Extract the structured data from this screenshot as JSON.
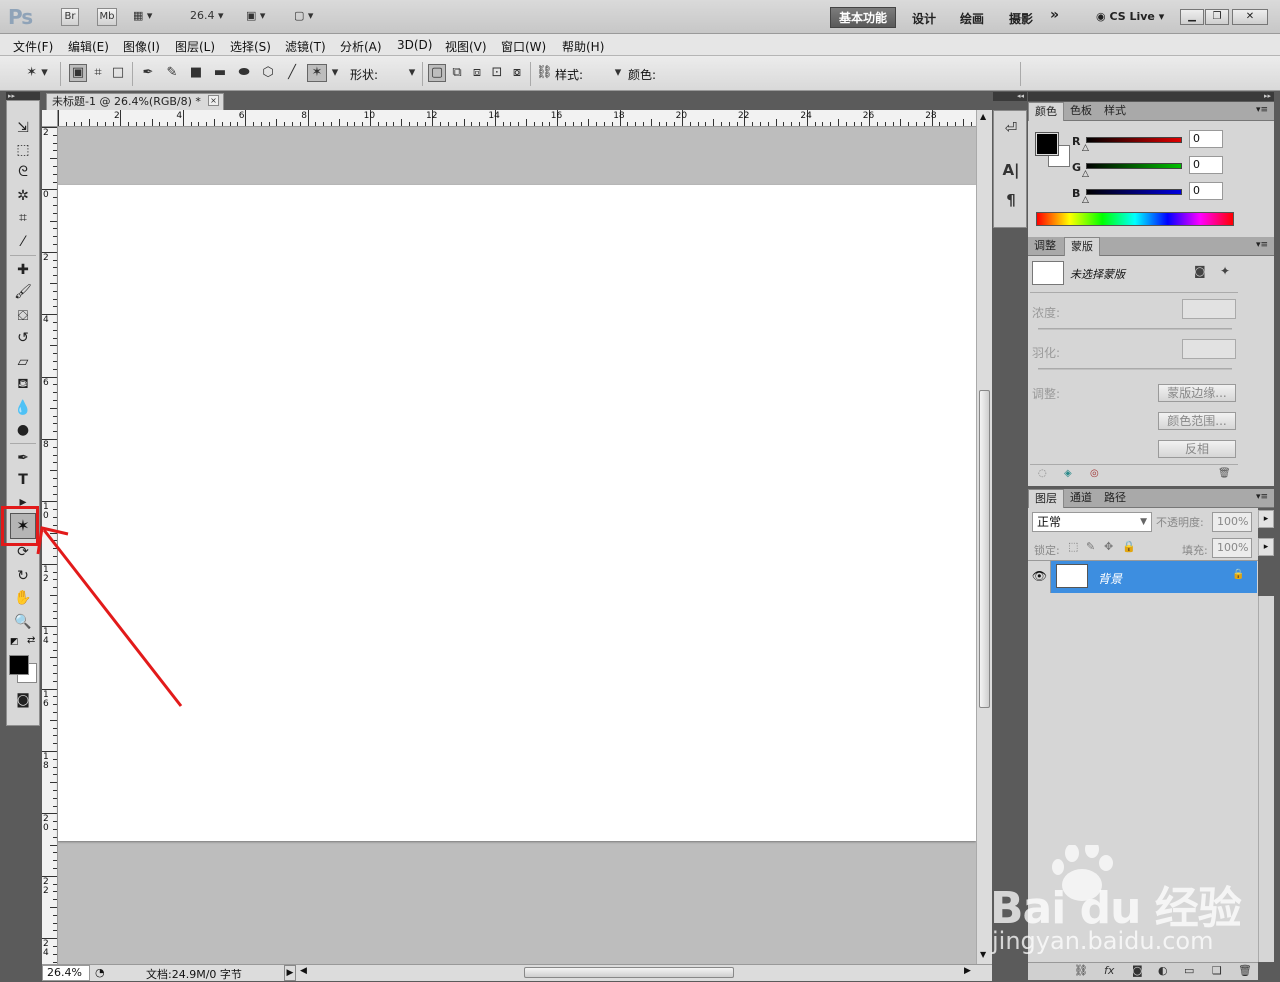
{
  "app": {
    "logo": "Ps",
    "bridge_label": "Br",
    "minibridge_label": "Mb",
    "zoom_value": "26.4",
    "workspaces": [
      "基本功能",
      "设计",
      "绘画",
      "摄影"
    ],
    "more_label": "»",
    "cslive_label": "CS Live"
  },
  "menu": [
    "文件(F)",
    "编辑(E)",
    "图像(I)",
    "图层(L)",
    "选择(S)",
    "滤镜(T)",
    "分析(A)",
    "3D(D)",
    "视图(V)",
    "窗口(W)",
    "帮助(H)"
  ],
  "options": {
    "shape_label": "形状:",
    "shape_value": "→",
    "style_label": "样式:",
    "color_label": "颜色:",
    "color_swatch": "#000000"
  },
  "document": {
    "tab_title": "未标题-1 @ 26.4%(RGB/8) *",
    "close_label": "×",
    "ruler_h": [
      "2",
      "4",
      "6",
      "8",
      "10",
      "12",
      "14",
      "16",
      "18",
      "20",
      "22",
      "24",
      "26",
      "28"
    ],
    "ruler_v": [
      "2",
      "0",
      "2",
      "4",
      "6",
      "8",
      "10",
      "12",
      "14",
      "16",
      "18",
      "20",
      "22",
      "24"
    ],
    "status_zoom": "26.4%",
    "status_info": "文档:24.9M/0 字节"
  },
  "color_panel": {
    "tabs": [
      "颜色",
      "色板",
      "样式"
    ],
    "channels": [
      {
        "label": "R",
        "value": "0",
        "color": "#e00000"
      },
      {
        "label": "G",
        "value": "0",
        "color": "#00c000"
      },
      {
        "label": "B",
        "value": "0",
        "color": "#0000e0"
      }
    ]
  },
  "mask_panel": {
    "tabs": [
      "调整",
      "蒙版"
    ],
    "no_selection": "未选择蒙版",
    "density_label": "浓度:",
    "feather_label": "羽化:",
    "refine_label": "调整:",
    "btn_edge": "蒙版边缘...",
    "btn_range": "颜色范围...",
    "btn_invert": "反相"
  },
  "layers_panel": {
    "tabs": [
      "图层",
      "通道",
      "路径"
    ],
    "blend_mode": "正常",
    "opacity_label": "不透明度:",
    "opacity_value": "100%",
    "lock_label": "锁定:",
    "fill_label": "填充:",
    "fill_value": "100%",
    "layer_name": "背景"
  },
  "watermark": {
    "brand": "Bai du 经验",
    "url": "jingyan.baidu.com"
  }
}
